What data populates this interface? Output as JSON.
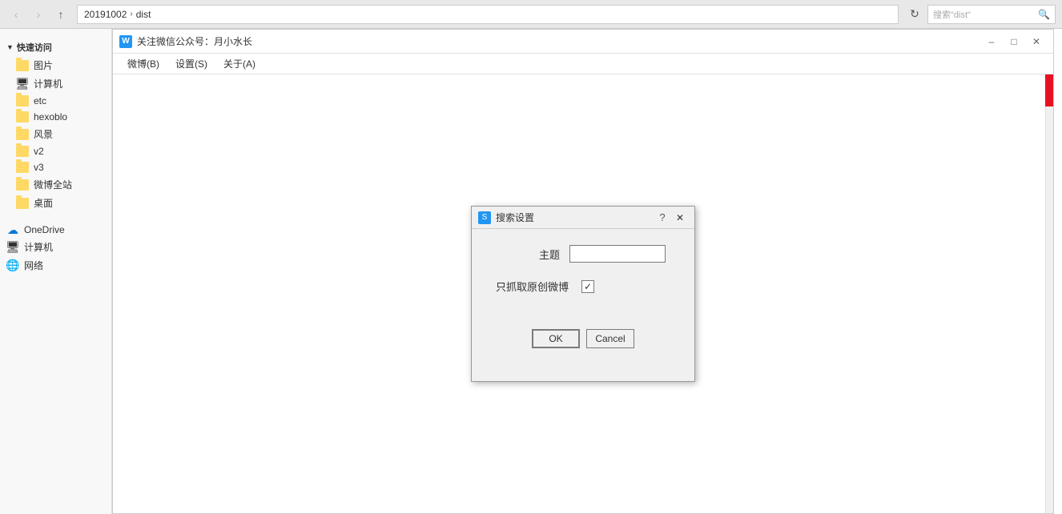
{
  "browser": {
    "back_btn": "‹",
    "forward_btn": "›",
    "up_btn": "↑",
    "breadcrumb": [
      "20191002",
      "dist"
    ],
    "search_placeholder": "搜索\"dist\"",
    "refresh_icon": "↻"
  },
  "sidebar": {
    "quick_access_label": "快速访问",
    "items": [
      {
        "label": "图片",
        "type": "folder"
      },
      {
        "label": "计算机",
        "type": "special"
      },
      {
        "label": "etc",
        "type": "folder"
      },
      {
        "label": "hexoblo",
        "type": "folder"
      },
      {
        "label": "风景",
        "type": "folder"
      },
      {
        "label": "v2",
        "type": "folder"
      },
      {
        "label": "v3",
        "type": "folder"
      },
      {
        "label": "微博全站",
        "type": "folder"
      },
      {
        "label": "桌面",
        "type": "folder"
      }
    ],
    "onedrive_label": "OneDrive",
    "computer_label": "计算机",
    "network_label": "网络"
  },
  "app_window": {
    "icon": "W",
    "title": "关注微信公众号：月小水长",
    "menu": [
      "微博(B)",
      "设置(S)",
      "关于(A)"
    ]
  },
  "dialog": {
    "icon": "S",
    "title": "搜索设置",
    "subject_label": "主题",
    "subject_value": "",
    "checkbox_label": "只抓取原创微博",
    "checkbox_checked": true,
    "ok_label": "OK",
    "cancel_label": "Cancel"
  }
}
